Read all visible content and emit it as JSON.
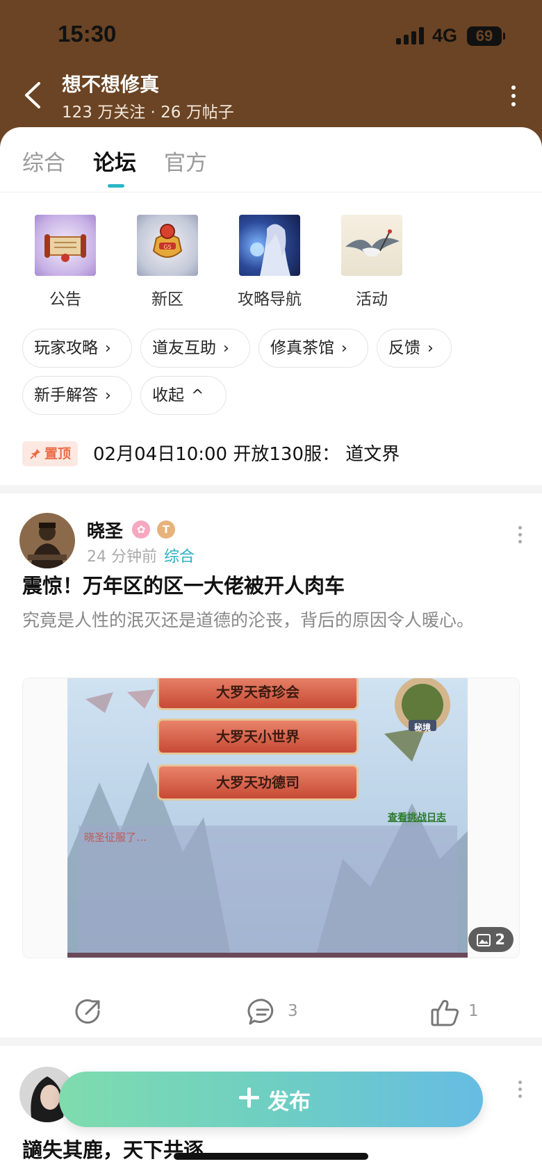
{
  "status_bar": {
    "time": "15:30",
    "network": "4G",
    "battery": "69"
  },
  "header": {
    "title": "想不想修真",
    "meta": "123 万关注 · 26 万帖子"
  },
  "tabs": [
    {
      "label": "综合",
      "active": false
    },
    {
      "label": "论坛",
      "active": true
    },
    {
      "label": "官方",
      "active": false
    }
  ],
  "quick_links": [
    {
      "label": "公告",
      "icon": "scroll-icon"
    },
    {
      "label": "新区",
      "icon": "treasure-icon"
    },
    {
      "label": "攻略导航",
      "icon": "fairy-icon"
    },
    {
      "label": "活动",
      "icon": "crane-icon"
    }
  ],
  "chips": [
    {
      "label": "玩家攻略",
      "chevron": "›"
    },
    {
      "label": "道友互助",
      "chevron": "›"
    },
    {
      "label": "修真茶馆",
      "chevron": "›"
    },
    {
      "label": "反馈",
      "chevron": "›"
    },
    {
      "label": "新手解答",
      "chevron": "›"
    },
    {
      "label": "收起",
      "chevron": "^"
    }
  ],
  "pinned": {
    "badge": "置顶",
    "text": "02月04日10:00 开放130服： 道文界"
  },
  "posts": [
    {
      "author": "晓圣",
      "badge_b": "T",
      "time": "24 分钟前",
      "category": "综合",
      "title": "震惊！万年区的区一大佬被开人肉车",
      "summary": "究竟是人性的泯灭还是道德的沦丧，背后的原因令人暖心。",
      "image": {
        "buttons": [
          "大罗天奇珍会",
          "大罗天小世界",
          "大罗天功德司"
        ],
        "secret_label": "秘境",
        "log_link": "查看挑战日志",
        "overlay_text": "晓圣征服了…"
      },
      "image_count": "2",
      "comments": "3",
      "likes": "1"
    },
    {
      "title": "讁失其鹿，天下共逐"
    }
  ],
  "fab": {
    "label": "发布"
  }
}
